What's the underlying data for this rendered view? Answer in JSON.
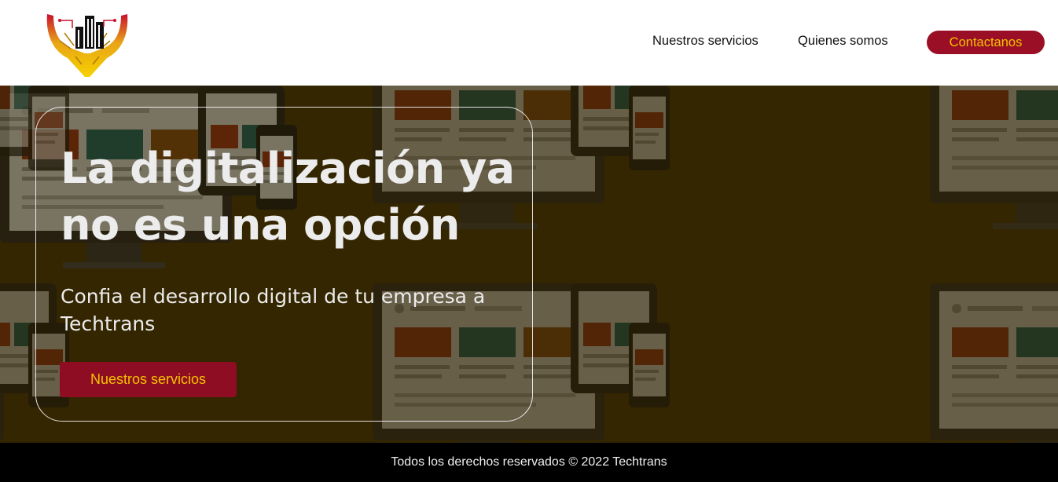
{
  "brand": {
    "logo_icon": "techtrans-hands-building-logo",
    "colors": {
      "primary": "#9a0f25",
      "accent": "#f3c300",
      "hero_bg": "#3a2a00"
    }
  },
  "nav": {
    "items": [
      {
        "label": "Nuestros servicios"
      },
      {
        "label": "Quienes somos"
      }
    ],
    "cta_label": "Contactanos"
  },
  "hero": {
    "title": "La digitalización ya no es una opción",
    "subtitle": "Confia el desarrollo digital de tu empresa a Techtrans",
    "button_label": "Nuestros servicios",
    "background_icon": "responsive-devices-pattern"
  },
  "footer": {
    "text": "Todos los derechos reservados © 2022 Techtrans"
  }
}
